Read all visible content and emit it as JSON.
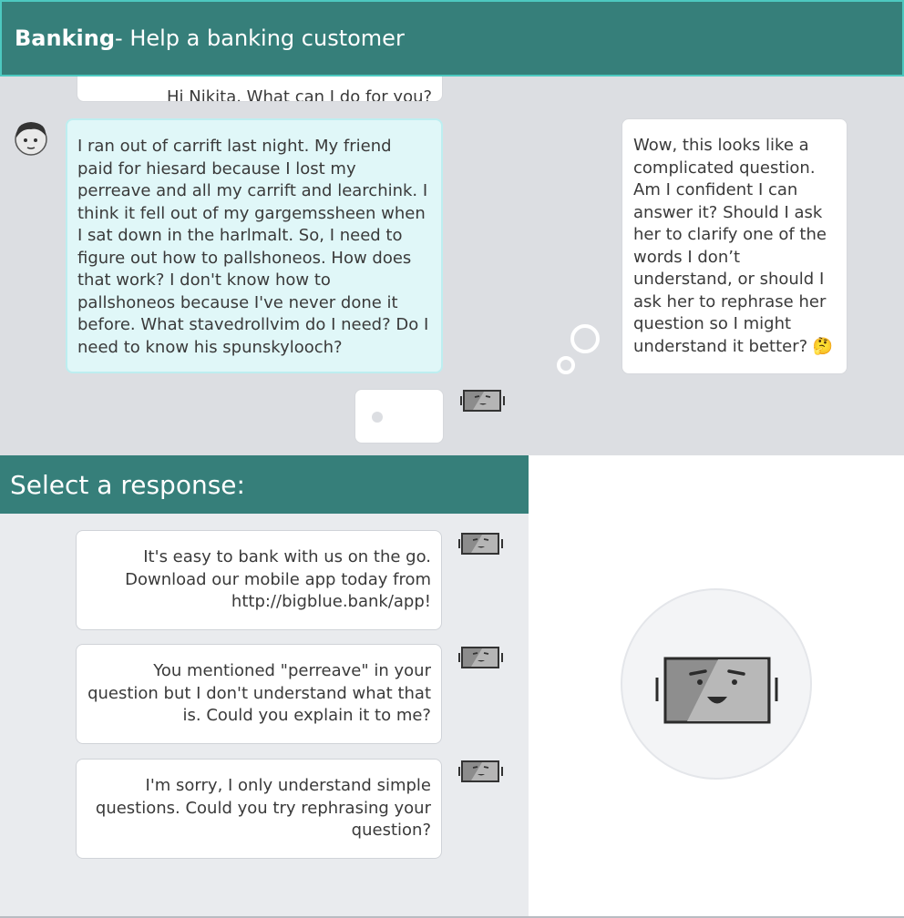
{
  "header": {
    "title_bold": "Banking",
    "title_rest": " - Help a banking customer"
  },
  "chat": {
    "previous_message": "Hi Nikita. What can I do for you?",
    "user_message": "I ran out of carrift last night. My friend paid for hiesard because I lost my perreave and all my carrift and learchink. I think it fell out of my gargemssheen when I sat down in the harlmalt. So, I need to figure out how to pallshoneos. How does that work? I don't know how to pallshoneos because I've never done it before. What stavedrollvim do I need? Do I need to know his spunskylooch?",
    "thought_text": "Wow, this looks like a complicated question. Am I confident I can answer it? Should I ask her to clarify one of the words I don’t understand, or should I ask her to rephrase her question so I might understand it better? 🤔"
  },
  "select": {
    "heading": "Select a response:",
    "options": [
      "It's easy to bank with us on the go. Download our mobile app today from http://bigblue.bank/app!",
      "You mentioned \"perreave\" in your question but I don't understand what that is. Could you explain it to me?",
      "I'm sorry, I only understand simple questions. Could you try rephrasing your question?"
    ]
  },
  "icons": {
    "user": "user-avatar-icon",
    "bot": "robot-icon"
  },
  "colors": {
    "header": "#367f7a",
    "accent_border": "#4dc9c0",
    "user_bubble": "#e0f7f8",
    "chat_bg": "#dcdee2"
  }
}
